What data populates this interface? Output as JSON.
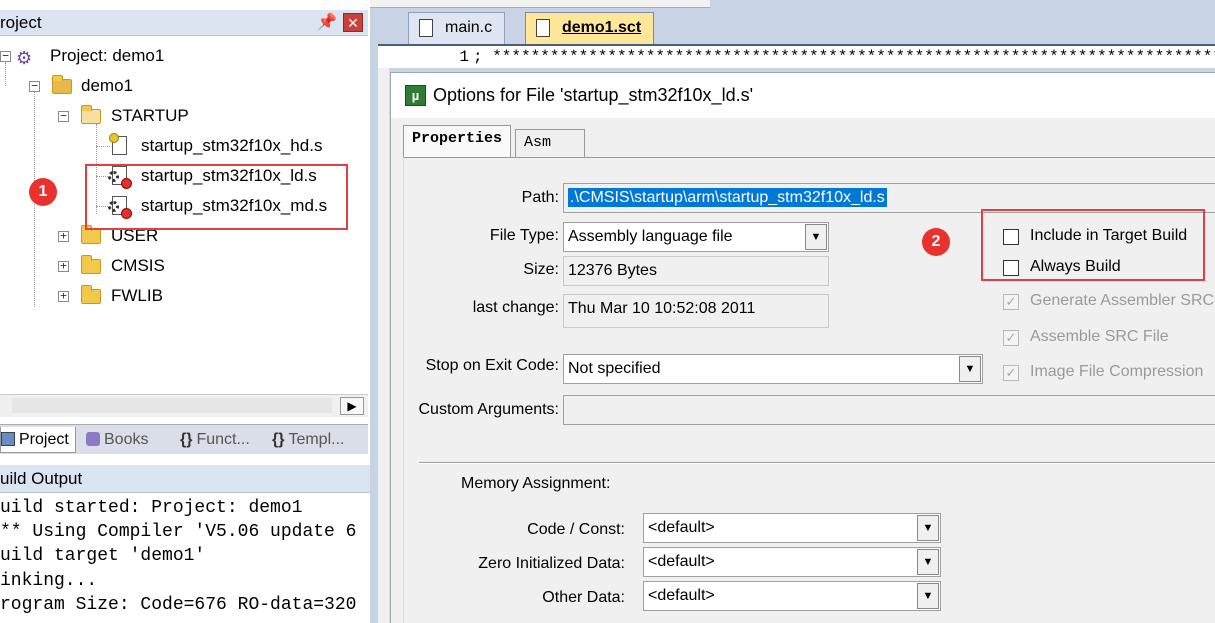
{
  "project_panel": {
    "title": "roject",
    "pin_icon": "pin-icon",
    "tree": {
      "root": "Project: demo1",
      "target": "demo1",
      "startup_folder": "STARTUP",
      "files": [
        "startup_stm32f10x_hd.s",
        "startup_stm32f10x_ld.s",
        "startup_stm32f10x_md.s"
      ],
      "folders": [
        "USER",
        "CMSIS",
        "FWLIB"
      ]
    },
    "tabs": [
      "Project",
      "Books",
      "Funct...",
      "Templ..."
    ],
    "tab_prefixes": [
      "{}",
      "{}"
    ]
  },
  "annotations": {
    "badge1": "1",
    "badge2": "2",
    "color": "#e04040"
  },
  "build_output": {
    "title": "uild Output",
    "lines": [
      "uild started: Project: demo1",
      "** Using Compiler 'V5.06 update 6",
      "uild target 'demo1'",
      "inking...",
      "rogram Size: Code=676 RO-data=320",
      ""
    ]
  },
  "editor": {
    "tabs": [
      "main.c",
      "demo1.sct"
    ],
    "line_number": "1",
    "line_text": "; *************************************************************************************************************"
  },
  "dialog": {
    "title": "Options for File 'startup_stm32f10x_ld.s'",
    "tabs": [
      "Properties",
      "Asm"
    ],
    "path_label": "Path:",
    "path_value": ".\\CMSIS\\startup\\arm\\startup_stm32f10x_ld.s",
    "filetype_label": "File Type:",
    "filetype_value": "Assembly language file",
    "size_label": "Size:",
    "size_value": "12376 Bytes",
    "lastchange_label": "last change:",
    "lastchange_value": "Thu Mar 10 10:52:08 2011",
    "stop_label": "Stop on Exit Code:",
    "stop_value": "Not specified",
    "custom_label": "Custom Arguments:",
    "custom_value": "",
    "checkboxes": [
      {
        "label": "Include in Target Build",
        "checked": false,
        "enabled": true
      },
      {
        "label": "Always Build",
        "checked": false,
        "enabled": true
      },
      {
        "label": "Generate Assembler SRC",
        "checked": true,
        "enabled": false
      },
      {
        "label": "Assemble SRC File",
        "checked": true,
        "enabled": false
      },
      {
        "label": "Image File Compression",
        "checked": true,
        "enabled": false
      }
    ],
    "memory": {
      "group_label": "Memory Assignment:",
      "rows": [
        {
          "label": "Code / Const:",
          "value": "<default>"
        },
        {
          "label": "Zero Initialized Data:",
          "value": "<default>"
        },
        {
          "label": "Other Data:",
          "value": "<default>"
        }
      ]
    }
  }
}
